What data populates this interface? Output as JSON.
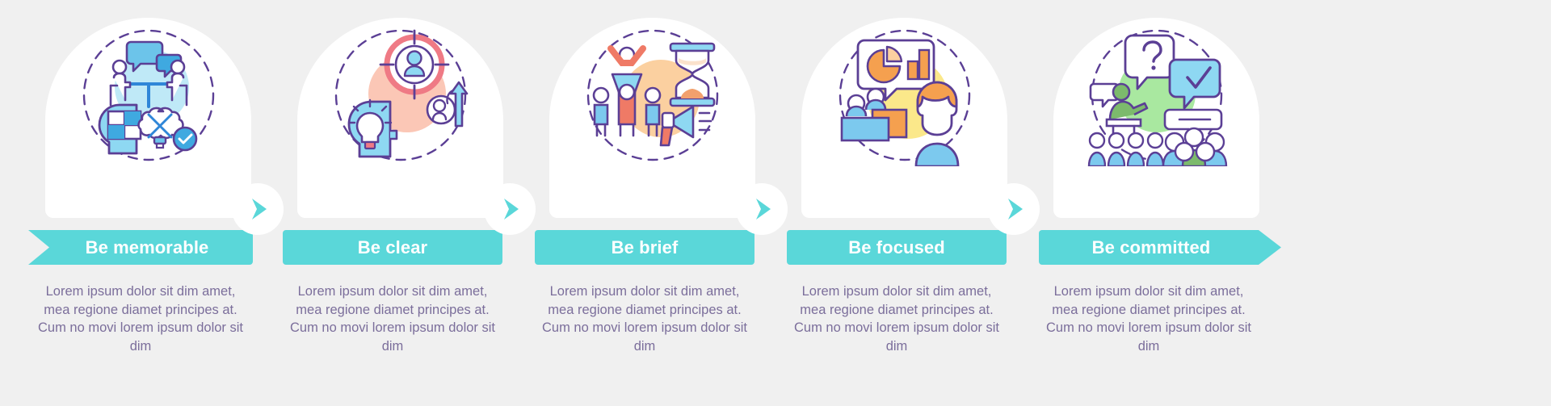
{
  "page": {
    "background_color": "#f0f0f0",
    "accent_color": "#5ad7d9",
    "text_color": "#7b6e9b",
    "card_color": "#ffffff"
  },
  "connector": {
    "icon": "chevron-right-icon",
    "color": "#5ad7d9"
  },
  "steps": [
    {
      "label": "Be memorable",
      "body": "Lorem ipsum dolor sit dim amet, mea regione diamet principes at. Cum no movi lorem ipsum dolor sit dim",
      "icon": "meeting-brainstorm-icon",
      "accent_circle_color": "#bfe9f7",
      "banner_shape": "notched-left"
    },
    {
      "label": "Be clear",
      "body": "Lorem ipsum dolor sit dim amet, mea regione diamet principes at. Cum no movi lorem ipsum dolor sit dim",
      "icon": "target-idea-icon",
      "accent_circle_color": "#fbc7b6",
      "banner_shape": "rectangle"
    },
    {
      "label": "Be brief",
      "body": "Lorem ipsum dolor sit dim amet, mea regione diamet principes at. Cum no movi lorem ipsum dolor sit dim",
      "icon": "hourglass-megaphone-icon",
      "accent_circle_color": "#fbd0a0",
      "banner_shape": "rectangle"
    },
    {
      "label": "Be focused",
      "body": "Lorem ipsum dolor sit dim amet, mea regione diamet principes at. Cum no movi lorem ipsum dolor sit dim",
      "icon": "presentation-chart-icon",
      "accent_circle_color": "#fbe88a",
      "banner_shape": "rectangle"
    },
    {
      "label": "Be committed",
      "body": "Lorem ipsum dolor sit dim amet, mea regione diamet principes at. Cum no movi lorem ipsum dolor sit dim",
      "icon": "qa-audience-icon",
      "accent_circle_color": "#a9e8a0",
      "banner_shape": "arrow-right"
    }
  ]
}
